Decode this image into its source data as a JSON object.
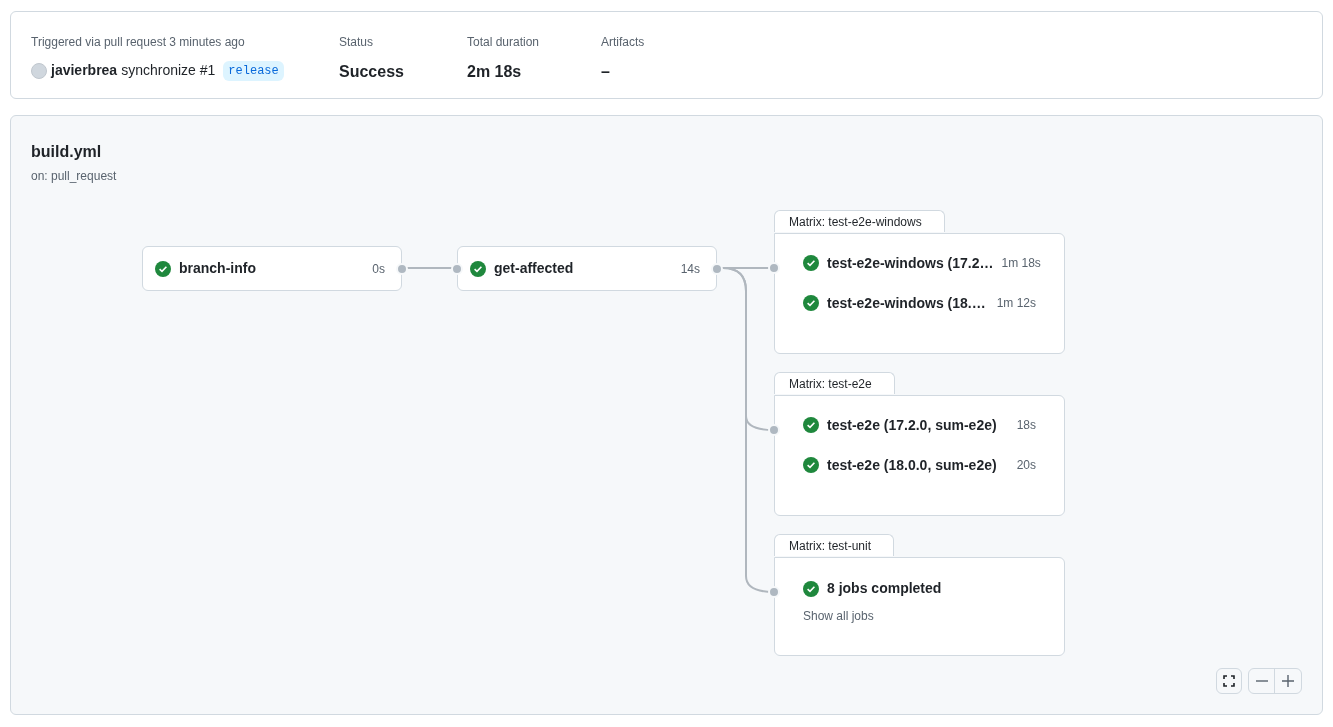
{
  "summary": {
    "trigger_label": "Triggered via pull request 3 minutes ago",
    "actor": "javierbrea",
    "event": "synchronize #1",
    "branch": "release",
    "fields": [
      {
        "label": "Status",
        "value": "Success"
      },
      {
        "label": "Total duration",
        "value": "2m 18s"
      },
      {
        "label": "Artifacts",
        "value": "–"
      }
    ]
  },
  "workflow": {
    "file": "build.yml",
    "trigger": "on: pull_request",
    "jobs": [
      {
        "name": "branch-info",
        "duration": "0s",
        "kind": "success"
      },
      {
        "name": "get-affected",
        "duration": "14s",
        "kind": "success"
      }
    ],
    "matrices": [
      {
        "title": "Matrix: test-e2e-windows",
        "jobs": [
          {
            "name": "test-e2e-windows (17.2…",
            "duration": "1m 18s",
            "kind": "success"
          },
          {
            "name": "test-e2e-windows (18.…",
            "duration": "1m 12s",
            "kind": "success"
          }
        ]
      },
      {
        "title": "Matrix: test-e2e",
        "jobs": [
          {
            "name": "test-e2e (17.2.0, sum-e2e)",
            "duration": "18s",
            "kind": "success"
          },
          {
            "name": "test-e2e (18.0.0, sum-e2e)",
            "duration": "20s",
            "kind": "success"
          }
        ]
      },
      {
        "title": "Matrix: test-unit",
        "summary": {
          "text": "8 jobs completed",
          "kind": "success"
        },
        "link": "Show all jobs"
      }
    ]
  }
}
